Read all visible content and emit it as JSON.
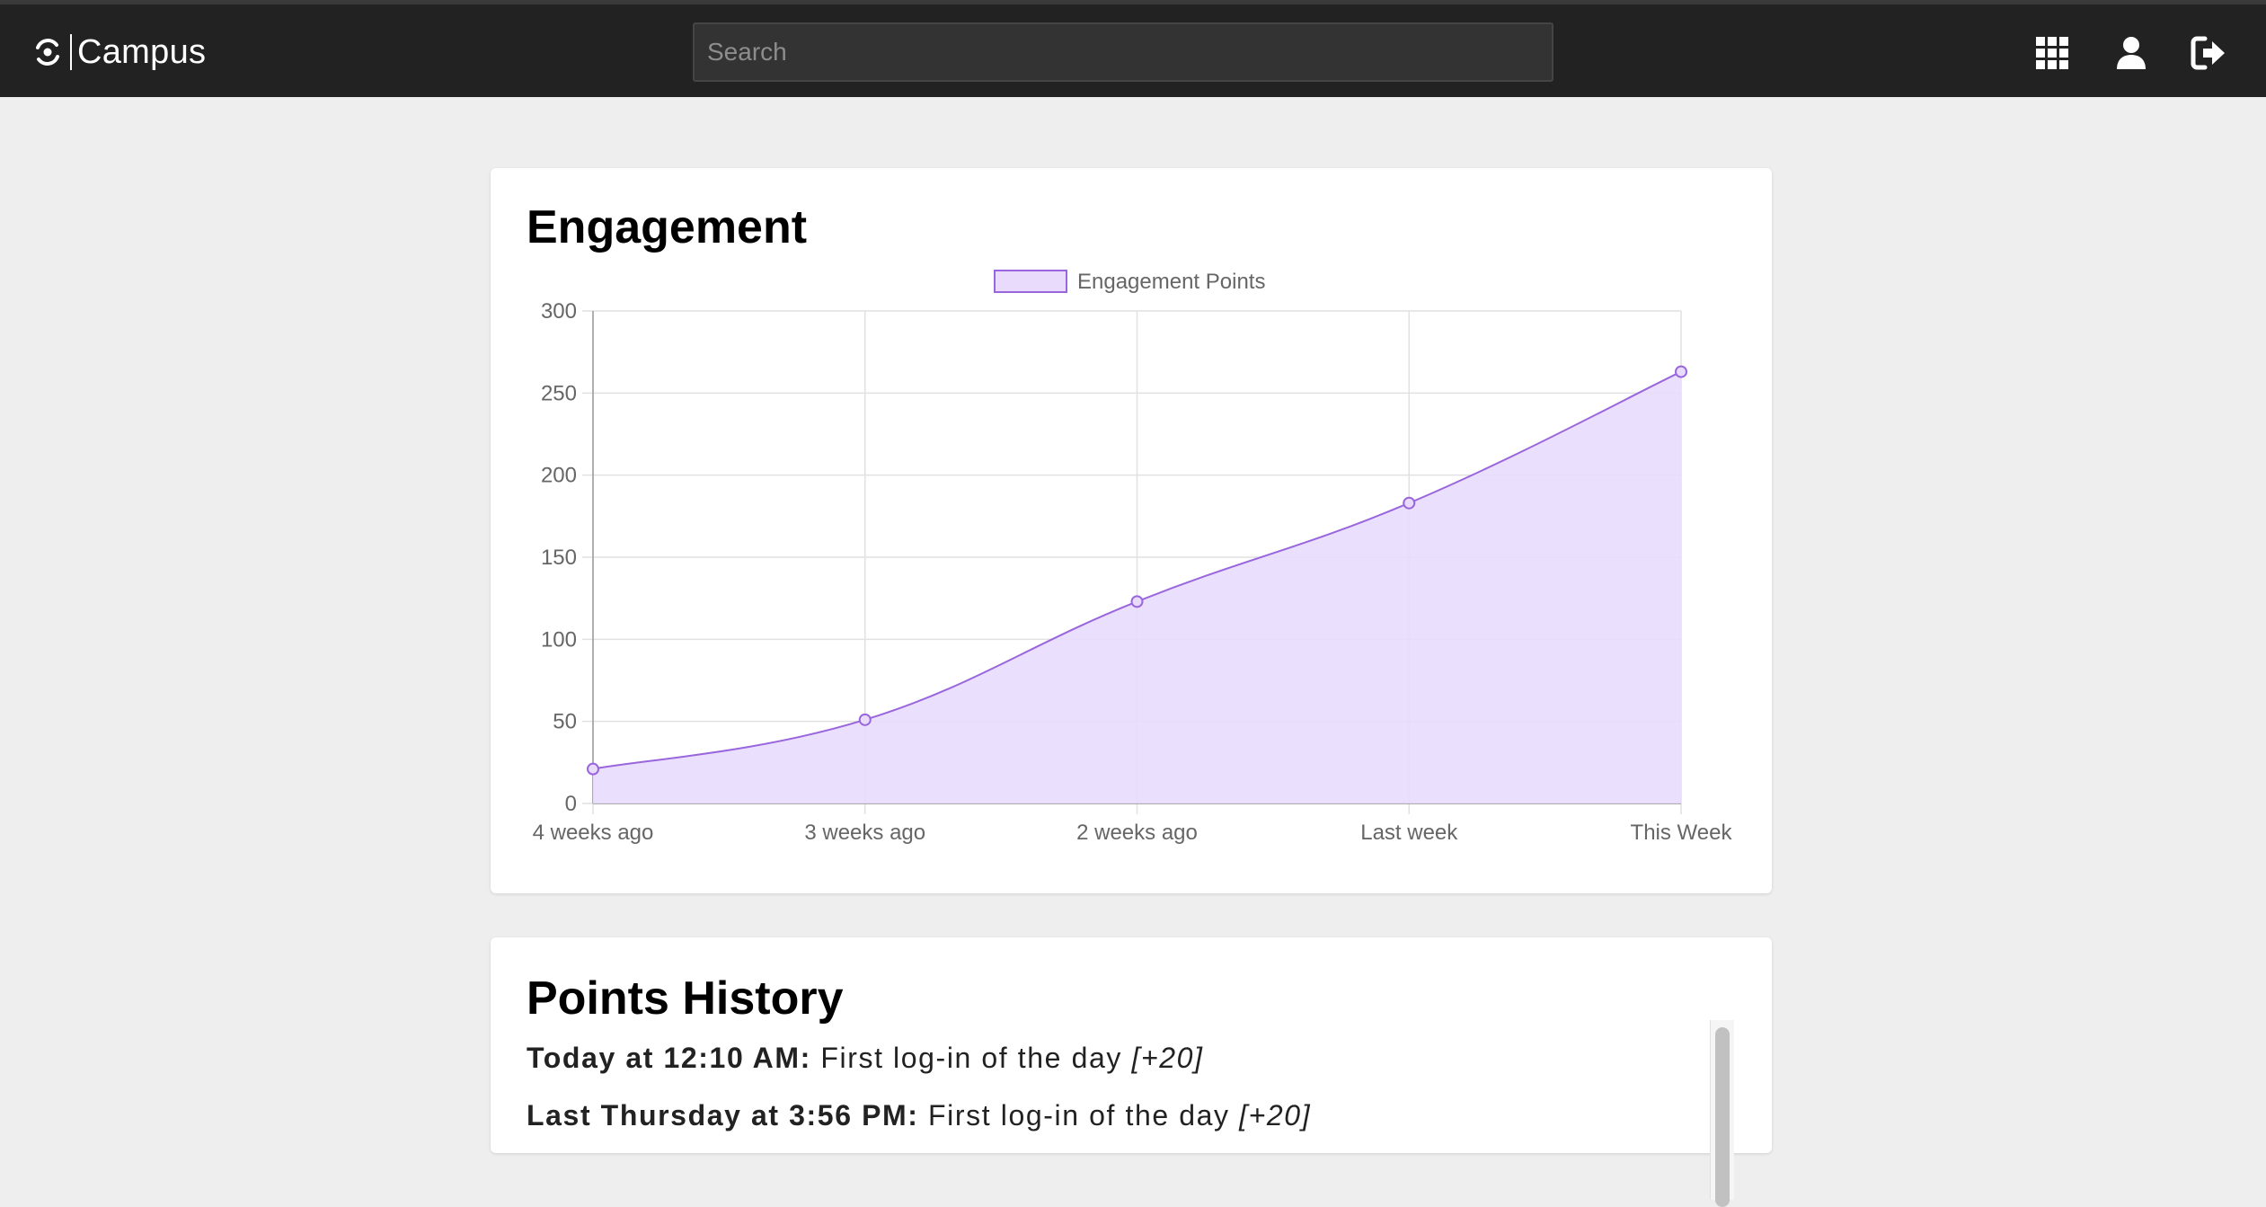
{
  "header": {
    "brand": "Campus",
    "search_placeholder": "Search",
    "icons": [
      "apps-grid-icon",
      "user-icon",
      "sign-out-icon"
    ]
  },
  "engagement": {
    "title": "Engagement"
  },
  "chart_data": {
    "type": "area",
    "categories": [
      "4 weeks ago",
      "3 weeks ago",
      "2 weeks ago",
      "Last week",
      "This Week"
    ],
    "series": [
      {
        "name": "Engagement Points",
        "values": [
          21,
          51,
          123,
          183,
          263
        ]
      }
    ],
    "ylim": [
      0,
      300
    ],
    "yticks": [
      0,
      50,
      100,
      150,
      200,
      250,
      300
    ],
    "grid": true,
    "legend": "top-center",
    "colors": {
      "line": "#9966dd",
      "fill": "#e8dbfc"
    }
  },
  "history": {
    "title": "Points History",
    "items": [
      {
        "time": "Today at 12:10 AM:",
        "text": "First log-in of the day",
        "points": "[+20]"
      },
      {
        "time": "Last Thursday at 3:56 PM:",
        "text": "First log-in of the day",
        "points": "[+20]"
      }
    ]
  }
}
